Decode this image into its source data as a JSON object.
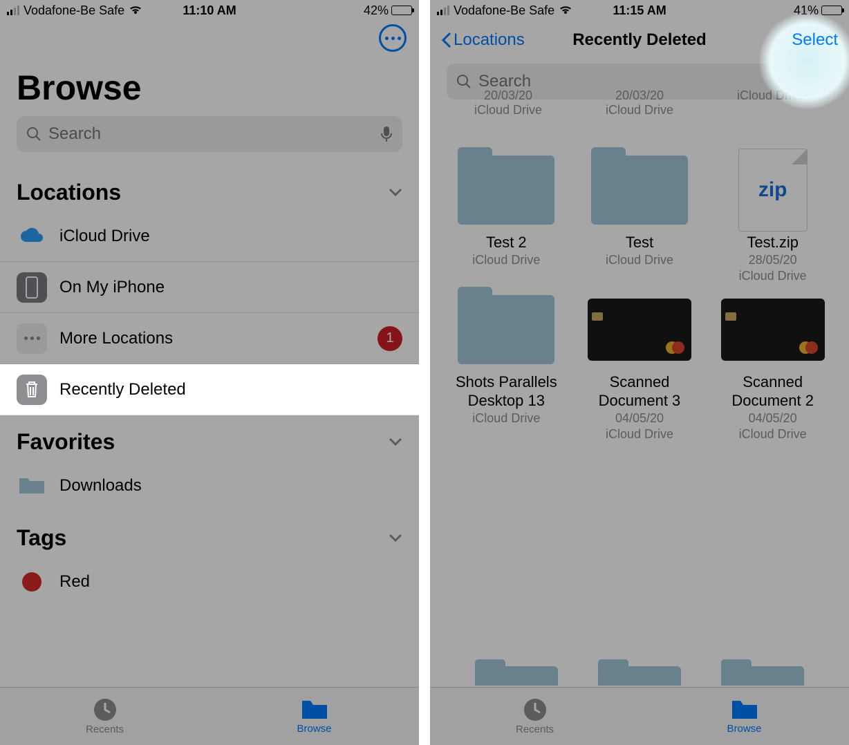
{
  "left": {
    "status": {
      "carrier": "Vodafone-Be Safe",
      "time": "11:10 AM",
      "battery_pct": "42%"
    },
    "nav": {},
    "title": "Browse",
    "search": {
      "placeholder": "Search"
    },
    "locations": {
      "header": "Locations",
      "items": [
        {
          "label": "iCloud Drive"
        },
        {
          "label": "On My iPhone"
        },
        {
          "label": "More Locations",
          "badge": "1"
        },
        {
          "label": "Recently Deleted"
        }
      ]
    },
    "favorites": {
      "header": "Favorites",
      "items": [
        {
          "label": "Downloads"
        }
      ]
    },
    "tags": {
      "header": "Tags",
      "items": [
        {
          "label": "Red"
        }
      ]
    },
    "tabs": {
      "recents": "Recents",
      "browse": "Browse"
    }
  },
  "right": {
    "status": {
      "carrier": "Vodafone-Be Safe",
      "time": "11:15 AM",
      "battery_pct": "41%"
    },
    "nav": {
      "back": "Locations",
      "title": "Recently Deleted",
      "select": "Select"
    },
    "search": {
      "placeholder": "Search"
    },
    "partial_top": [
      {
        "date": "20/03/20",
        "loc": "iCloud Drive"
      },
      {
        "date": "20/03/20",
        "loc": "iCloud Drive"
      },
      {
        "loc": "iCloud Drive"
      }
    ],
    "files": [
      {
        "name": "Test 2",
        "sub1": "iCloud Drive",
        "sub2": "",
        "type": "folder"
      },
      {
        "name": "Test",
        "sub1": "iCloud Drive",
        "sub2": "",
        "type": "folder"
      },
      {
        "name": "Test.zip",
        "sub1": "28/05/20",
        "sub2": "iCloud Drive",
        "type": "zip"
      },
      {
        "name": "Shots Parallels Desktop 13",
        "sub1": "iCloud Drive",
        "sub2": "",
        "type": "folder"
      },
      {
        "name": "Scanned Document 3",
        "sub1": "04/05/20",
        "sub2": "iCloud Drive",
        "type": "card"
      },
      {
        "name": "Scanned Document 2",
        "sub1": "04/05/20",
        "sub2": "iCloud Drive",
        "type": "card"
      }
    ],
    "tabs": {
      "recents": "Recents",
      "browse": "Browse"
    }
  }
}
